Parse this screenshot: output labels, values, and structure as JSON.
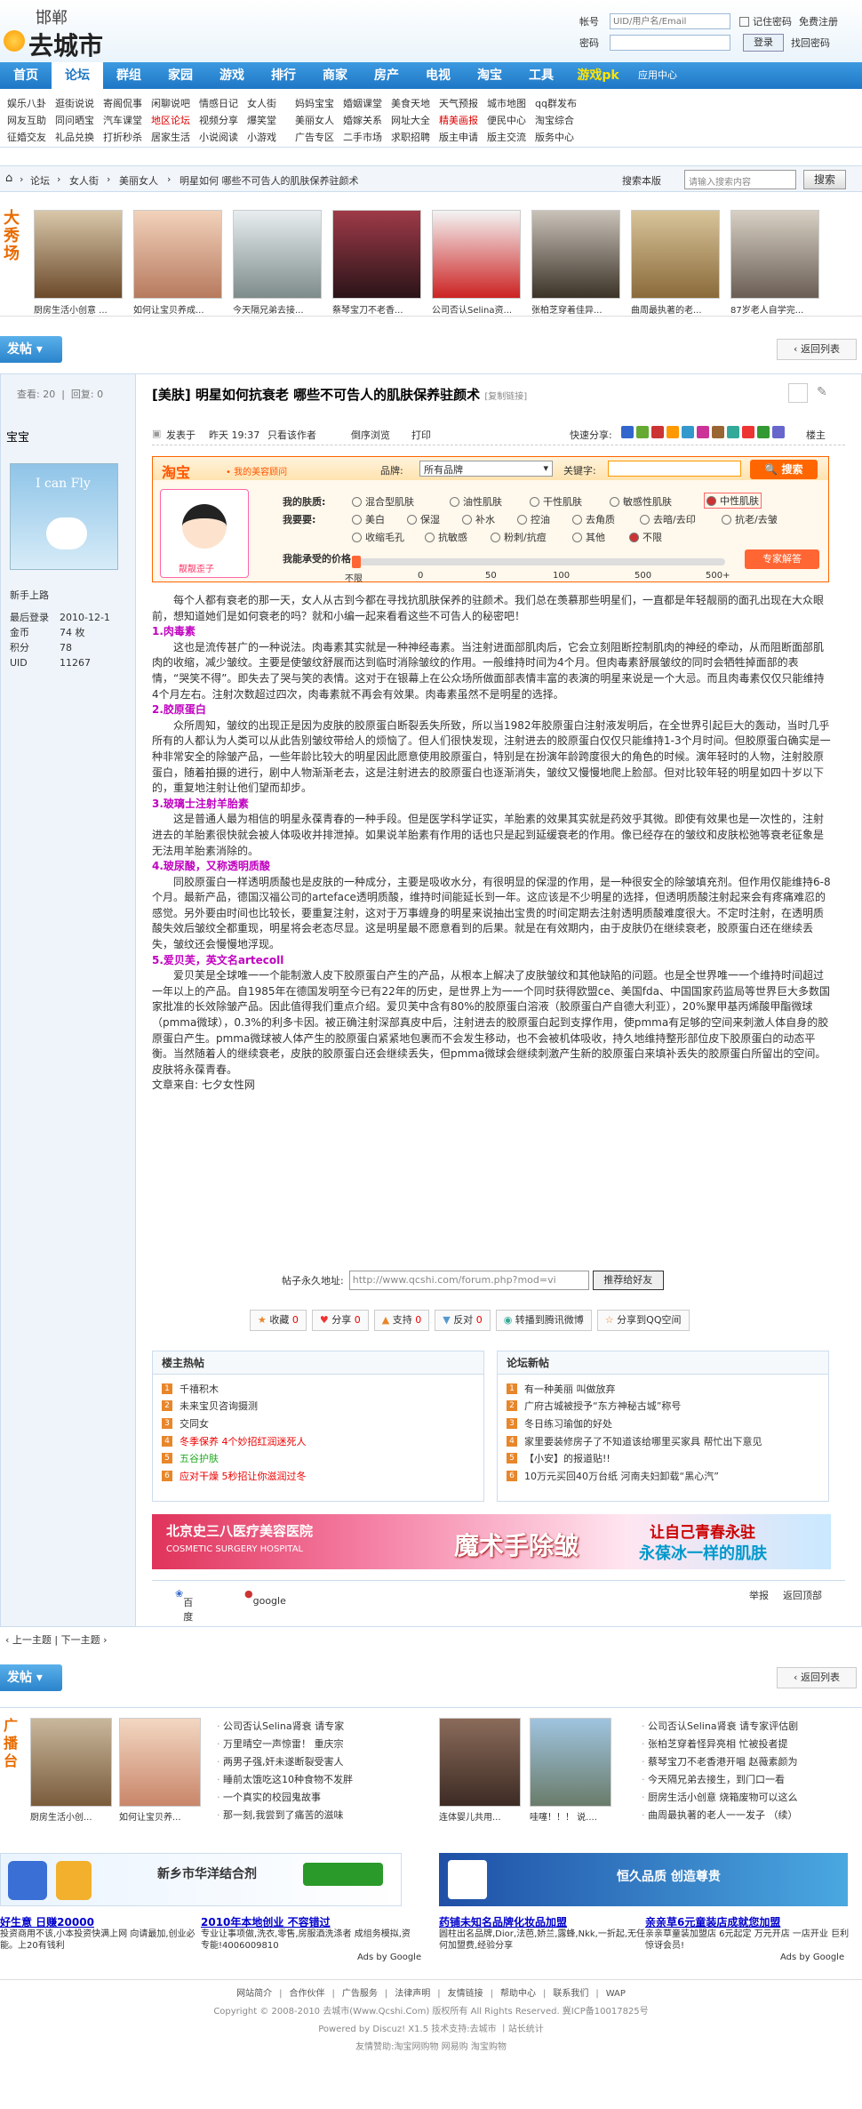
{
  "header": {
    "city": "邯郸",
    "site_name": "去城市",
    "login": {
      "account_label": "帐号",
      "account_placeholder": "UID/用户名/Email",
      "remember": "记住密码",
      "register": "免费注册",
      "password_label": "密码",
      "login_btn": "登录",
      "recover": "找回密码"
    }
  },
  "nav": {
    "items": [
      "首页",
      "论坛",
      "群组",
      "家园",
      "游戏",
      "排行",
      "商家",
      "房产",
      "电视",
      "淘宝",
      "工具",
      "游戏pk",
      "应用中心"
    ],
    "active": 1
  },
  "subnav": [
    [
      "娱乐八卦",
      "逛街说说",
      "寄阁侃事",
      "闲聊说吧",
      "情感日记",
      "女人街",
      "妈妈宝宝",
      "婚姻课堂",
      "美食天地",
      "天气预报",
      "城市地图",
      "qq群发布"
    ],
    [
      "网友互助",
      "同问晒宝",
      "汽车课堂",
      "地区论坛",
      "视频分享",
      "爆笑堂",
      "美丽女人",
      "婚嫁关系",
      "网址大全",
      "精美画报",
      "便民中心",
      "淘宝综合"
    ],
    [
      "征婚交友",
      "礼品兑换",
      "打折秒杀",
      "居家生活",
      "小说阅读",
      "小游戏",
      "广告专区",
      "二手市场",
      "求职招聘",
      "版主申请",
      "版主交流",
      "版务中心"
    ]
  ],
  "breadcrumb": {
    "items": [
      "论坛",
      "女人街",
      "美丽女人",
      "明星如何 哪些不可告人的肌肤保养驻颜术"
    ],
    "search_label": "搜索本版",
    "search_placeholder": "请输入搜索内容",
    "search_btn": "搜索"
  },
  "show": {
    "logo": "大秀场",
    "thumbs": [
      "厨房生活小创意 ...",
      "如何让宝贝养成...",
      "今天隔兄弟去接...",
      "蔡琴宝刀不老香...",
      "公司否认Selina资...",
      "张柏芝穿着佳异...",
      "曲周最执著的老...",
      "87岁老人自学完..."
    ]
  },
  "post_btn": "发帖",
  "back_btn": "返回列表",
  "sidebar": {
    "views_label": "查看:",
    "views": "20",
    "replies_label": "回复:",
    "replies": "0",
    "author": "宝宝",
    "avatar_text": "I can Fly",
    "level": "新手上路",
    "info": [
      [
        "最后登录",
        "2010-12-1"
      ],
      [
        "金币",
        "74 枚"
      ],
      [
        "积分",
        "78"
      ],
      [
        "UID",
        "11267"
      ]
    ]
  },
  "post": {
    "title": "[美肤] 明星如何抗衰老 哪些不可告人的肌肤保养驻颜术",
    "copy_link": "[复制链接]",
    "posted_label": "发表于",
    "posted_time": "昨天 19:37",
    "only_author": "只看该作者",
    "reverse": "倒序浏览",
    "print": "打印",
    "quick_share": "快速分享:",
    "floor": "楼主"
  },
  "taobao": {
    "logo": "淘宝",
    "sub": "• 我的美容顾问",
    "brand_label": "品牌:",
    "brand_value": "所有品牌",
    "kw_label": "关键字:",
    "search_btn": "搜索",
    "girl_name": "靓靓歪子",
    "skin_label": "我的肤质:",
    "skin_opts": [
      "混合型肌肤",
      "油性肌肤",
      "干性肌肤",
      "敏感性肌肤",
      "中性肌肤"
    ],
    "need_label": "我要要:",
    "need_row1": [
      "美白",
      "保湿",
      "补水",
      "控油",
      "去角质",
      "去暗/去印",
      "抗老/去皱"
    ],
    "need_row2": [
      "收缩毛孔",
      "抗敏感",
      "粉刺/抗痘",
      "其他",
      "不限"
    ],
    "price_label": "我能承受的价格:",
    "price_ticks": [
      "不限",
      "0",
      "50",
      "100",
      "500",
      "500+"
    ],
    "expert_btn": "专家解答"
  },
  "content": [
    {
      "t": "p",
      "v": "每个人都有衰老的那一天，女人从古到今都在寻找抗肌肤保养的驻颜术。我们总在羡慕那些明星们，一直都是年轻靓丽的面孔出现在大众眼前，想知道她们是如何衰老的吗？就和小编一起来看看这些不可告人的秘密吧！"
    },
    {
      "t": "h",
      "v": "1.肉毒素"
    },
    {
      "t": "p",
      "v": "这也是流传甚广的一种说法。肉毒素其实就是一种神经毒素。当注射进面部肌肉后，它会立刻阻断控制肌肉的神经的牵动，从而阻断面部肌肉的收缩，减少皱纹。主要是使皱纹舒展而达到临时消除皱纹的作用。一般维持时间为4个月。但肉毒素舒展皱纹的同时会牺牲掉面部的表情，“哭笑不得”。即失去了哭与笑的表情。这对于在银幕上在公众场所做面部表情丰富的表演的明星来说是一个大忌。而且肉毒素仅仅只能维持4个月左右。注射次数超过四次，肉毒素就不再会有效果。肉毒素虽然不是明星的选择。"
    },
    {
      "t": "h",
      "v": "2.胶原蛋白"
    },
    {
      "t": "p",
      "v": "众所周知，皱纹的出现正是因为皮肤的胶原蛋白断裂丢失所致，所以当1982年胶原蛋白注射液发明后，在全世界引起巨大的轰动，当时几乎所有的人都认为人类可以从此告别皱纹带给人的烦恼了。但人们很快发现，注射进去的胶原蛋白仅仅只能维持1-3个月时间。但胶原蛋白确实是一种非常安全的除皱产品，一些年龄比较大的明星因此愿意使用胶原蛋白，特别是在扮演年龄跨度很大的角色的时候。演年轻时的人物，注射胶原蛋白，随着拍摄的进行，剧中人物渐渐老去，这是注射进去的胶原蛋白也逐渐消失，皱纹又慢慢地爬上脸部。但对比较年轻的明星如四十岁以下的，重复地注射让他们望而却步。"
    },
    {
      "t": "h",
      "v": "3.玻璃士注射羊胎素"
    },
    {
      "t": "p",
      "v": "这是普通人最为相信的明星永葆青春的一种手段。但是医学科学证实，羊胎素的效果其实就是药效乎其微。即使有效果也是一次性的，注射进去的羊胎素很快就会被人体吸收并排泄掉。如果说羊胎素有作用的话也只是起到延缓衰老的作用。像已经存在的皱纹和皮肤松弛等衰老征象是无法用羊胎素消除的。"
    },
    {
      "t": "h",
      "v": "4.玻尿酸，又称透明质酸"
    },
    {
      "t": "p",
      "v": "同胶原蛋白一样透明质酸也是皮肤的一种成分，主要是吸收水分，有很明显的保湿的作用，是一种很安全的除皱填充剂。但作用仅能维持6-8个月。最新产品，德国汉福公司的arteface透明质酸，维持时间能延长到一年。这应该是不少明星的选择，但透明质酸注射起来会有疼痛难忍的感觉。另外要由时间也比较长，要重复注射，这对于万事缠身的明星来说抽出宝贵的时间定期去注射透明质酸难度很大。不定时注射，在透明质酸失效后皱纹全都重现，明星将会老态尽显。这是明星最不愿意看到的后果。就是在有效期内，由于皮肤仍在继续衰老，胶原蛋白还在继续丢失，皱纹还会慢慢地浮现。"
    },
    {
      "t": "h",
      "v": "5.爱贝芙，英文名artecoll"
    },
    {
      "t": "p",
      "v": "爱贝芙是全球唯一一个能制激人皮下胶原蛋白产生的产品，从根本上解决了皮肤皱纹和其他缺陷的问题。也是全世界唯一一个维持时间超过一年以上的产品。自1985年在德国发明至今已有22年的历史，是世界上为一一个同时获得欧盟ce、美国fda、中国国家药监局等世界巨大多数国家批准的长效除皱产品。因此值得我们重点介绍。爱贝芙中含有80%的胶原蛋白溶液（胶原蛋白产自德大利亚），20%聚甲基丙烯酸甲酯微球（pmma微球），0.3%的利多卡因。被正确注射深部真皮中后，注射进去的胶原蛋白起到支撑作用，使pmma有足够的空间来刺激人体自身的胶原蛋白产生。pmma微球被人体产生的胶原蛋白紧紧地包裹而不会发生移动，也不会被机体吸收，持久地维持整形部位皮下胶原蛋白的动态平衡。当然随着人的继续衰老，皮肤的胶原蛋白还会继续丢失，但pmma微球会继续刺激产生新的胶原蛋白来填补丢失的胶原蛋白所留出的空间。皮肤将永葆青春。"
    },
    {
      "t": "p",
      "v": "文章来自: 七夕女性网"
    }
  ],
  "permalink": {
    "label": "帖子永久地址:",
    "url": "http://www.qcshi.com/forum.php?mod=vi",
    "btn": "推荐给好友"
  },
  "actions": [
    {
      "label": "收藏",
      "n": "0"
    },
    {
      "label": "分享",
      "n": "0"
    },
    {
      "label": "支持",
      "n": "0"
    },
    {
      "label": "反对",
      "n": "0"
    },
    {
      "label": "转播到腾讯微博",
      "n": ""
    },
    {
      "label": "分享到QQ空间",
      "n": ""
    }
  ],
  "hot_panel": {
    "title": "楼主热帖",
    "items": [
      {
        "text": "千禧积木",
        "c": ""
      },
      {
        "text": "未来宝贝咨询摄测",
        "c": ""
      },
      {
        "text": "交同女",
        "c": ""
      },
      {
        "text": "冬季保养 4个妙招红润迷死人",
        "c": "red"
      },
      {
        "text": "五谷护肤",
        "c": "green"
      },
      {
        "text": "应对干燥 5秒招让你滋润过冬",
        "c": "red"
      }
    ]
  },
  "new_panel": {
    "title": "论坛新帖",
    "items": [
      "有一种美丽 叫做放弃",
      "广府古城被授予“东方神秘古城”称号",
      "冬日练习瑜伽的好处",
      "家里要装修房子了不知道该给哪里买家具 帮忙出下意见",
      "【小安】的报道贴!!",
      "10万元买回40万台纸 河南夫妇卸载“黑心汽”"
    ]
  },
  "banner": {
    "t1": "北京史三八医疗美容医院",
    "t2": "COSMETIC SURGERY HOSPITAL",
    "t3": "魔术手除皱",
    "t4": "让自己青春永驻",
    "t5": "永葆冰一样的肌肤"
  },
  "post_footer": {
    "baidu": "百度",
    "google": "google",
    "report": "举报",
    "top": "返回顶部"
  },
  "pager": {
    "prev": "上一主题",
    "next": "下一主题"
  },
  "bottom": {
    "logo": "广播台",
    "thumbs": [
      "厨房生活小创...",
      "如何让宝贝养...",
      "连体婴儿共用...",
      "哇噻！！！ 说...."
    ],
    "list1": [
      "公司否认Selina肾衰 请专家",
      "万里晴空一声惊雷！ 重庆宗",
      "两男子强,奸未遂断裂受害人",
      "睡前太饿吃这10种食物不发胖",
      "一个真实的校园鬼故事",
      "那一刻,我尝到了痛苦的滋味"
    ],
    "list2": [
      "公司否认Selina肾衰 请专家评估剧",
      "张柏芝穿着怪异亮相 忙被投者提",
      "蔡琴宝刀不老香港开唱 赵薇素颜为",
      "今天隔兄弟去接生，到门口一看",
      "厨房生活小创意 烧箱废物可以这么",
      "曲周最执著的老人一一发子 （续）"
    ]
  },
  "ads": {
    "left_title": "新乡市华洋结合剂",
    "right_title": "恒久品质 创造尊贵",
    "texts": [
      {
        "t": "好生意 日赚20000",
        "d": "投资商用不该,小本投资快满上网 向请最加,创业必能。上20有钱利"
      },
      {
        "t": "2010年本地创业 不容错过",
        "d": "专业让事项做,洗衣,零售,房服酒洗涤者 成组务模拟,资专能!4006009810"
      },
      {
        "t": "药铺未知名品牌化妆品加盟",
        "d": "圆柱出名品牌,Dior,法芭,娇兰,露蜂,Nkk,一折起,无任何加盟费,经验分享"
      },
      {
        "t": "亲亲草6元童装店成就您加盟",
        "d": "亲亲草童装加盟店 6元起定 万元开店 一店开业 巨利惊讶会员!"
      }
    ],
    "google": "Ads by Google"
  },
  "footer": {
    "links": [
      "网站简介",
      "合作伙伴",
      "广告服务",
      "法律声明",
      "友情链接",
      "帮助中心",
      "联系我们",
      "WAP"
    ],
    "copyright": "Copyright © 2008-2010 去城市(Www.Qcshi.Com) 版权所有 All Rights Reserved. 冀ICP备10017825号",
    "powered": "Powered by Discuz! X1.5  技术支持:去城市 丨站长统计",
    "friends": "友情赞助:淘宝网购物  网易购  淘宝购物"
  }
}
